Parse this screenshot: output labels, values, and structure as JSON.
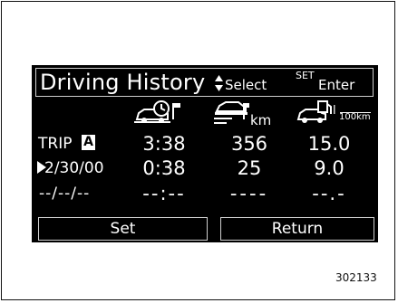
{
  "header": {
    "title": "Driving History",
    "select_label": "Select",
    "set_label": "SET",
    "enter_label": "Enter"
  },
  "icons": {
    "time_icon": "car-clock-icon",
    "distance_icon": "car-road-icon",
    "economy_icon": "car-fuel-icon",
    "economy_unit_top": "l",
    "economy_unit_bottom": "100km",
    "distance_unit": "km"
  },
  "rows": [
    {
      "label": "TRIP",
      "badge": "A",
      "time": "3:38",
      "distance": "356",
      "economy": "15.0"
    },
    {
      "label": "2/30/00",
      "time": "0:38",
      "distance": "25",
      "economy": "9.0"
    },
    {
      "label": "--/--/--",
      "time": "--:--",
      "distance": "----",
      "economy": "--.-"
    }
  ],
  "buttons": {
    "set_label": "Set",
    "return_label": "Return"
  },
  "figure_number": "302133"
}
